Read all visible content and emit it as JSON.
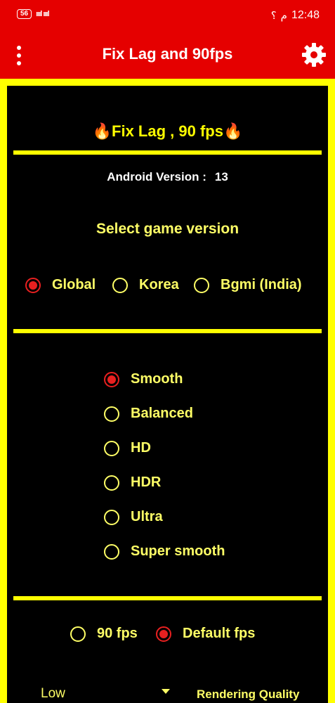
{
  "status_bar": {
    "battery": "56",
    "signal": "ᴵᴵll ᴵᴵll",
    "indicator": "⸮",
    "ampm": "م",
    "time": "12:48"
  },
  "app_bar": {
    "title": "Fix Lag and 90fps",
    "menu_icon": "more-vert-icon",
    "settings_icon": "gear-icon"
  },
  "headline": "🔥Fix Lag , 90 fps🔥",
  "android": {
    "label": "Android Version :",
    "value": "13"
  },
  "game_version": {
    "title": "Select game version",
    "options": [
      {
        "label": "Global",
        "checked": true
      },
      {
        "label": "Korea",
        "checked": false
      },
      {
        "label": "Bgmi (India)",
        "checked": false
      }
    ]
  },
  "graphics": {
    "options": [
      {
        "label": "Smooth",
        "checked": true
      },
      {
        "label": "Balanced",
        "checked": false
      },
      {
        "label": "HD",
        "checked": false
      },
      {
        "label": "HDR",
        "checked": false
      },
      {
        "label": "Ultra",
        "checked": false
      },
      {
        "label": "Super smooth",
        "checked": false
      }
    ]
  },
  "fps": {
    "options": [
      {
        "label": "90 fps",
        "checked": false
      },
      {
        "label": "Default fps",
        "checked": true
      }
    ]
  },
  "rendering": {
    "selected": "Low",
    "label": "Rendering Quality"
  },
  "colors": {
    "app_bar": "#e50000",
    "accent_yellow": "#ffff00",
    "text_yellow": "#ffff66",
    "radio_checked": "#e82020",
    "background": "#000000"
  }
}
